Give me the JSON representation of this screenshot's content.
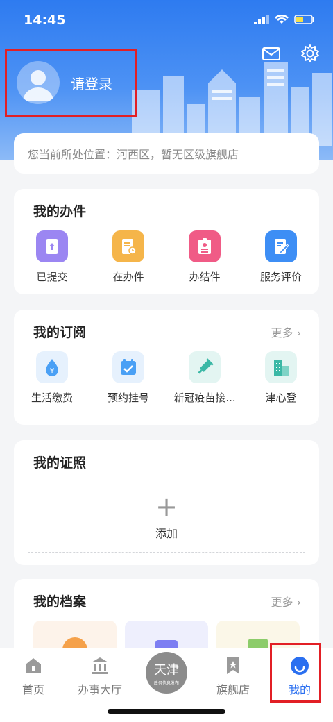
{
  "status_bar": {
    "time": "14:45"
  },
  "login": {
    "label": "请登录"
  },
  "location": {
    "text": "您当前所处位置：河西区，暂无区级旗舰店"
  },
  "my_tasks": {
    "title": "我的办件",
    "items": [
      {
        "label": "已提交",
        "icon": "upload-doc-icon",
        "color": "#9b86f2"
      },
      {
        "label": "在办件",
        "icon": "doc-clock-icon",
        "color": "#f5b54a"
      },
      {
        "label": "办结件",
        "icon": "badge-doc-icon",
        "color": "#f05b86"
      },
      {
        "label": "服务评价",
        "icon": "edit-doc-icon",
        "color": "#3d8ef5"
      }
    ]
  },
  "subscriptions": {
    "title": "我的订阅",
    "more": "更多",
    "items": [
      {
        "label": "生活缴费",
        "icon": "yen-drop-icon",
        "color": "#4aa0f5"
      },
      {
        "label": "预约挂号",
        "icon": "calendar-check-icon",
        "color": "#4aa0f5"
      },
      {
        "label": "新冠疫苗接...",
        "icon": "syringe-icon",
        "color": "#3bb8a6"
      },
      {
        "label": "津心登",
        "icon": "building-icon",
        "color": "#3bb8a6"
      }
    ]
  },
  "certificates": {
    "title": "我的证照",
    "add_label": "添加"
  },
  "archives": {
    "title": "我的档案",
    "more": "更多",
    "tiles": [
      "yen-coin-icon",
      "clipboard-icon",
      "tax-doc-icon"
    ]
  },
  "tabbar": {
    "tabs": [
      {
        "label": "首页",
        "icon": "home-icon"
      },
      {
        "label": "办事大厅",
        "icon": "hall-icon"
      },
      {
        "label": "",
        "icon": "tianjin-logo-icon"
      },
      {
        "label": "旗舰店",
        "icon": "flagship-store-icon"
      },
      {
        "label": "我的",
        "icon": "profile-icon"
      }
    ],
    "center_logo_text": "天津",
    "center_logo_sub": "政务信息发布"
  },
  "colors": {
    "primary": "#2a6ff0",
    "highlight_border": "#e21f25"
  }
}
